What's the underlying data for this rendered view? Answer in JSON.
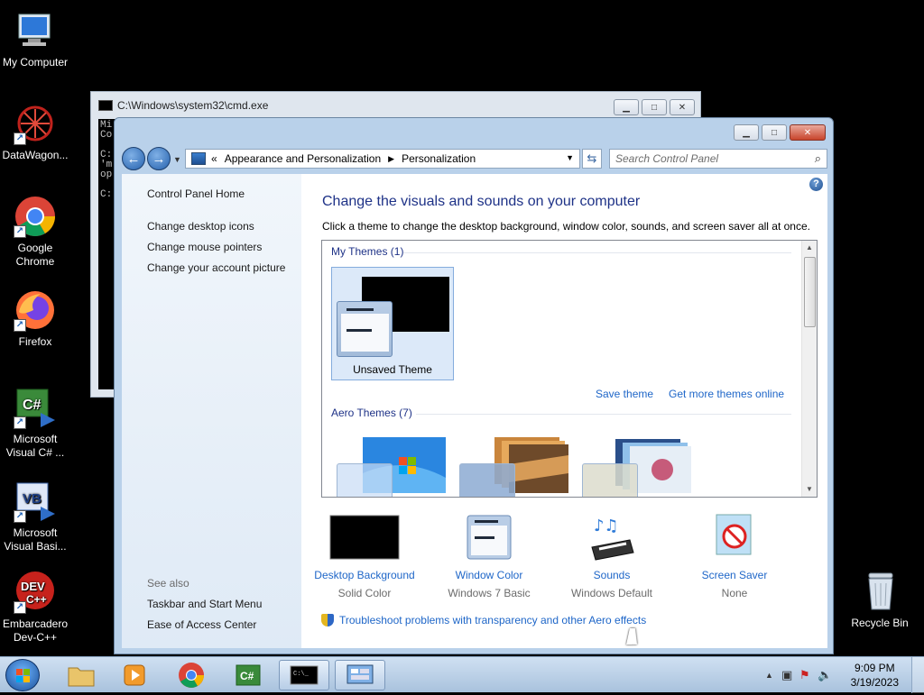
{
  "desktop": {
    "icons": [
      {
        "label": "My Computer",
        "icon": "computer-icon"
      },
      {
        "label": "DataWagon...",
        "icon": "datawagon-icon"
      },
      {
        "label": "Google Chrome",
        "icon": "chrome-icon"
      },
      {
        "label": "Firefox",
        "icon": "firefox-icon"
      },
      {
        "label": "Microsoft Visual C# ...",
        "icon": "visual-csharp-icon"
      },
      {
        "label": "Microsoft Visual Basi...",
        "icon": "visual-basic-icon"
      },
      {
        "label": "Embarcadero Dev-C++",
        "icon": "devcpp-icon"
      },
      {
        "label": "Recycle Bin",
        "icon": "recycle-bin-icon"
      }
    ]
  },
  "cmd_window": {
    "title": "C:\\Windows\\system32\\cmd.exe",
    "console_lines": [
      "Mi",
      "Co",
      "",
      "C:",
      "'m",
      "op",
      "",
      "C:"
    ]
  },
  "personalization": {
    "address": {
      "overflow": "«",
      "crumb1": "Appearance and Personalization",
      "crumb2": "Personalization"
    },
    "search_placeholder": "Search Control Panel",
    "left": {
      "home": "Control Panel Home",
      "links": [
        "Change desktop icons",
        "Change mouse pointers",
        "Change your account picture"
      ],
      "see_also": "See also",
      "see_also_links": [
        "Taskbar and Start Menu",
        "Ease of Access Center"
      ]
    },
    "heading": "Change the visuals and sounds on your computer",
    "subtext": "Click a theme to change the desktop background, window color, sounds, and screen saver all at once.",
    "my_themes_header": "My Themes (1)",
    "unsaved_theme": "Unsaved Theme",
    "save_theme": "Save theme",
    "get_more": "Get more themes online",
    "aero_header": "Aero Themes (7)",
    "options": [
      {
        "label": "Desktop Background",
        "value": "Solid Color"
      },
      {
        "label": "Window Color",
        "value": "Windows 7 Basic"
      },
      {
        "label": "Sounds",
        "value": "Windows Default"
      },
      {
        "label": "Screen Saver",
        "value": "None"
      }
    ],
    "troubleshoot": "Troubleshoot problems with transparency and other Aero effects"
  },
  "taskbar": {
    "time": "9:09 PM",
    "date": "3/19/2023"
  },
  "colors": {
    "link": "#1e66c8",
    "heading": "#1e3287",
    "taskbar": "#b9d1ea"
  }
}
